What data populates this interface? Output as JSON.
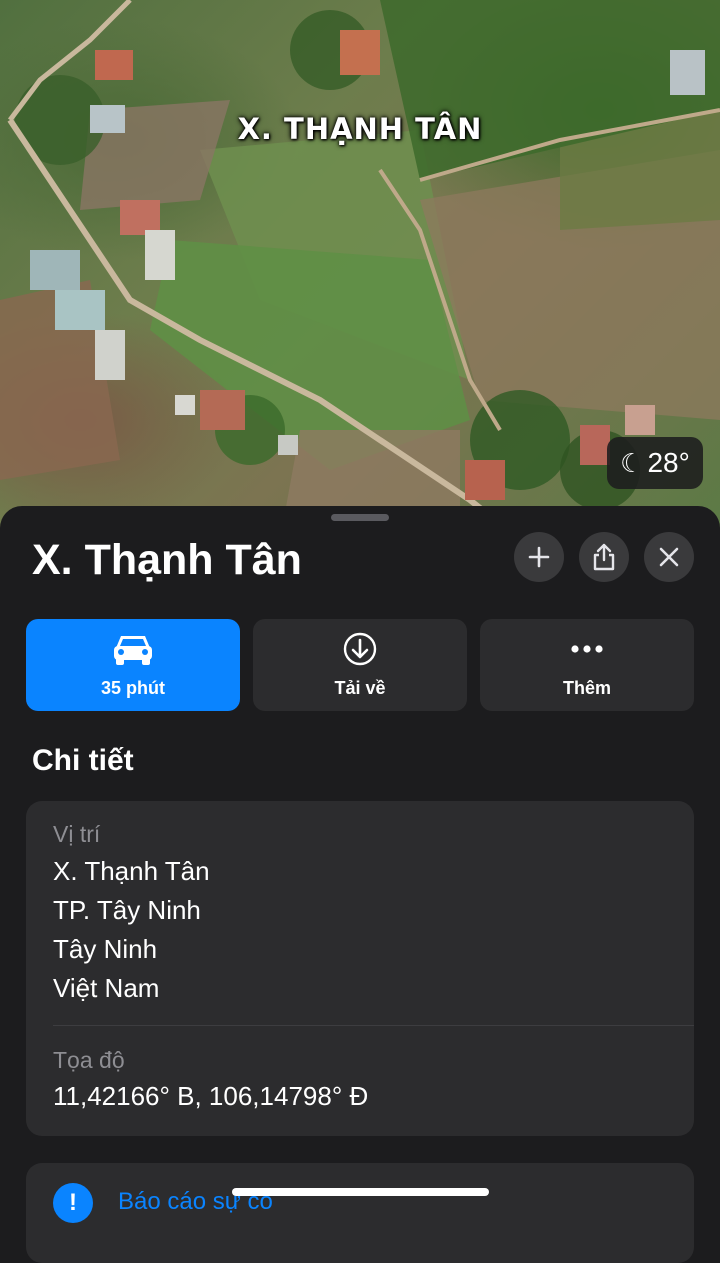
{
  "map": {
    "place_label": "X. THẠNH TÂN",
    "weather": {
      "icon": "moon-stars-icon",
      "temperature": "28°"
    }
  },
  "place": {
    "title": "X. Thạnh Tân",
    "header_buttons": [
      "plus-icon",
      "share-icon",
      "close-icon"
    ],
    "actions": [
      {
        "icon": "car-icon",
        "label": "35 phút",
        "highlighted": true
      },
      {
        "icon": "download-icon",
        "label": "Tải về"
      },
      {
        "icon": "more-icon",
        "label": "Thêm"
      }
    ]
  },
  "details": {
    "section_title": "Chi tiết",
    "location_label": "Vị trí",
    "location_lines": [
      "X. Thạnh Tân",
      "TP. Tây Ninh",
      "Tây Ninh",
      "Việt Nam"
    ],
    "coordinates_label": "Tọa độ",
    "coordinates_value": "11,42166° B, 106,14798° Đ"
  },
  "report": {
    "icon": "report-icon",
    "label": "Báo cáo sự cố"
  },
  "colors": {
    "accent": "#0a84ff",
    "sheet": "#1c1c1e",
    "card": "#2c2c2e",
    "secondary_text": "#8e8e93"
  }
}
